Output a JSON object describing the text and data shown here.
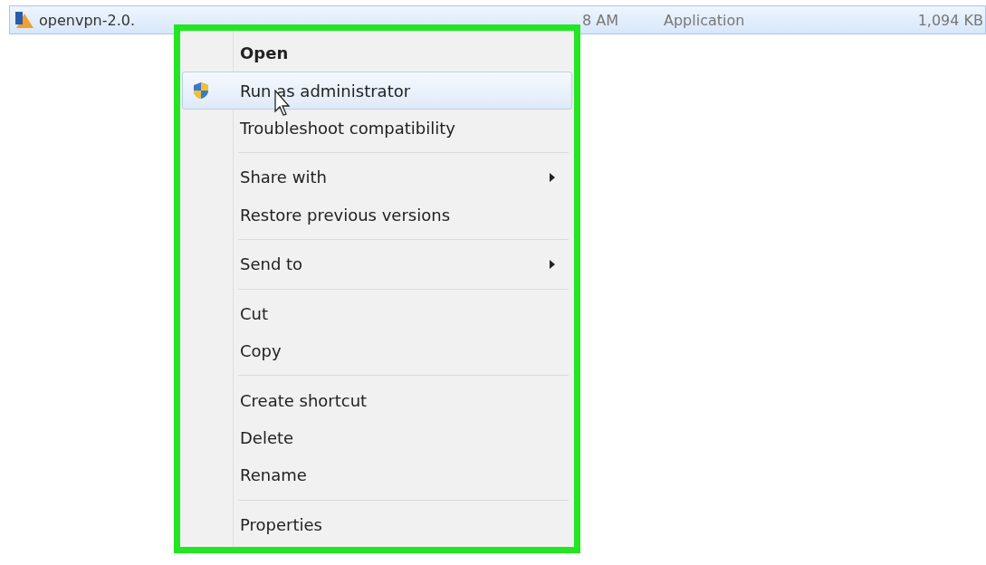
{
  "file_row": {
    "selected": true,
    "name": "openvpn-2.0.",
    "date_modified": "8 AM",
    "type": "Application",
    "size": "1,094 KB"
  },
  "context_menu": {
    "items": [
      {
        "kind": "item",
        "label": "Open",
        "default": true,
        "selected": false,
        "submenu": false
      },
      {
        "kind": "shield_item",
        "label": "Run as administrator",
        "default": false,
        "selected": true,
        "submenu": false
      },
      {
        "kind": "item",
        "label": "Troubleshoot compatibility",
        "default": false,
        "selected": false,
        "submenu": false
      },
      {
        "kind": "separator"
      },
      {
        "kind": "item",
        "label": "Share with",
        "default": false,
        "selected": false,
        "submenu": true
      },
      {
        "kind": "item",
        "label": "Restore previous versions",
        "default": false,
        "selected": false,
        "submenu": false
      },
      {
        "kind": "separator"
      },
      {
        "kind": "item",
        "label": "Send to",
        "default": false,
        "selected": false,
        "submenu": true
      },
      {
        "kind": "separator"
      },
      {
        "kind": "item",
        "label": "Cut",
        "default": false,
        "selected": false,
        "submenu": false
      },
      {
        "kind": "item",
        "label": "Copy",
        "default": false,
        "selected": false,
        "submenu": false
      },
      {
        "kind": "separator"
      },
      {
        "kind": "item",
        "label": "Create shortcut",
        "default": false,
        "selected": false,
        "submenu": false
      },
      {
        "kind": "item",
        "label": "Delete",
        "default": false,
        "selected": false,
        "submenu": false
      },
      {
        "kind": "item",
        "label": "Rename",
        "default": false,
        "selected": false,
        "submenu": false
      },
      {
        "kind": "separator"
      },
      {
        "kind": "item",
        "label": "Properties",
        "default": false,
        "selected": false,
        "submenu": false
      }
    ]
  }
}
